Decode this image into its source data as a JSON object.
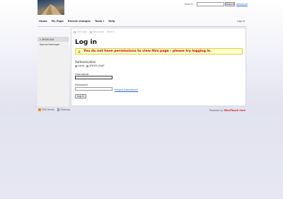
{
  "header": {
    "search_label": "Search:",
    "search_value": "",
    "search_button": "Search",
    "advanced_link": "Advanced"
  },
  "nav": {
    "items": [
      "Home",
      "My Page",
      "Recent changes",
      "Tools ▾",
      "Help"
    ],
    "login": "Log in"
  },
  "sidebar": {
    "items": [
      "MYON Slot",
      "Special:UserLogin"
    ]
  },
  "toolbar": {
    "items": [
      "Edit page",
      "New page",
      "More ▾"
    ]
  },
  "main": {
    "title": "Log in",
    "warning": "You do not have permissions to view this page - please try logging in.",
    "auth_label": "Authentication",
    "auth_options": [
      "Local",
      "MYON LDAP"
    ],
    "auth_selected": "MYON LDAP",
    "username_label": "Username",
    "username_value": "",
    "password_label": "Password",
    "password_value": "",
    "forgot_link": "Forgot password?",
    "login_button": "Log in"
  },
  "footer": {
    "rss": "RSS feeds",
    "sitemap": "Sitemap",
    "powered_prefix": "Powered by",
    "powered_brand": "MindTouch Core"
  },
  "colors": {
    "warning_bg": "#ffffc8",
    "warning_text": "#bb0000",
    "link": "#3366cc",
    "brand": "#cc2222"
  }
}
